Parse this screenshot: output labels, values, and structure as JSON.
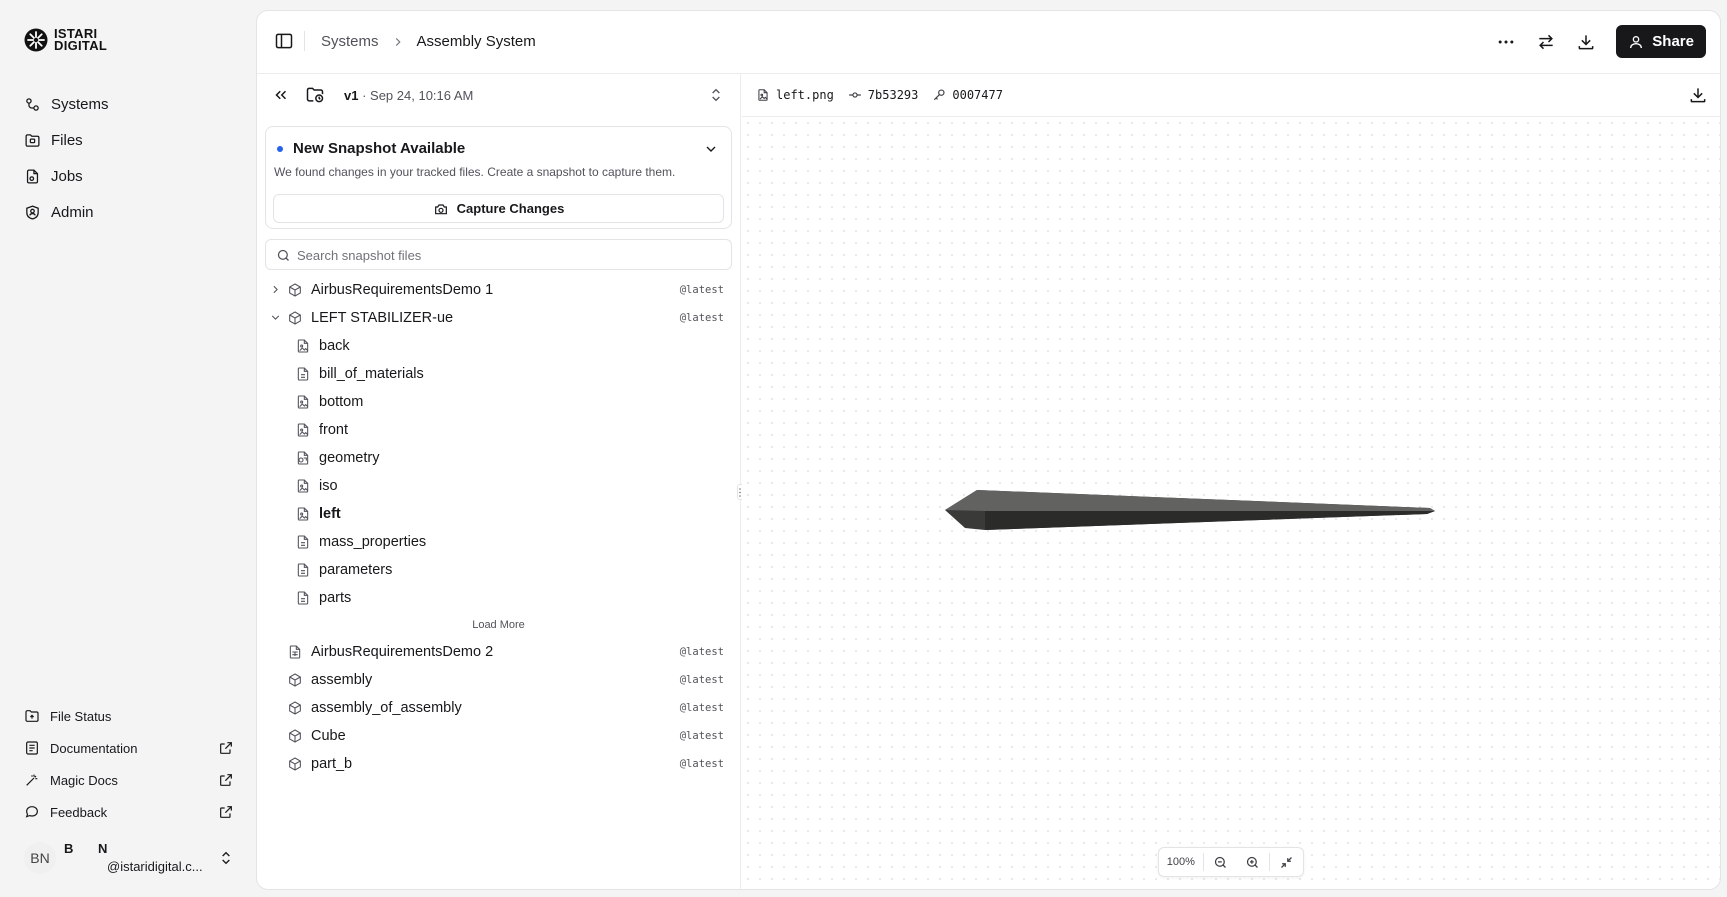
{
  "brand": {
    "line1": "ISTARI",
    "line2": "DIGITAL"
  },
  "nav": [
    {
      "label": "Systems",
      "icon": "systems-icon"
    },
    {
      "label": "Files",
      "icon": "files-icon"
    },
    {
      "label": "Jobs",
      "icon": "jobs-icon"
    },
    {
      "label": "Admin",
      "icon": "admin-icon"
    }
  ],
  "bottom_nav": [
    {
      "label": "File Status",
      "icon": "file-status-icon"
    },
    {
      "label": "Documentation",
      "icon": "documentation-icon",
      "external": true
    },
    {
      "label": "Magic Docs",
      "icon": "magic-wand-icon",
      "external": true
    },
    {
      "label": "Feedback",
      "icon": "chat-bubble-icon",
      "external": true
    }
  ],
  "user": {
    "initials": "BN",
    "first": "B",
    "last": "N",
    "email": "@istaridigital.c..."
  },
  "breadcrumb": {
    "parent": "Systems",
    "current": "Assembly System"
  },
  "toolbar": {
    "share_label": "Share"
  },
  "version": {
    "label": "v1",
    "date": "· Sep 24, 10:16 AM"
  },
  "snapshot": {
    "title": "New Snapshot Available",
    "description": "We found changes in your tracked files. Create a snapshot to capture them.",
    "capture_label": "Capture Changes"
  },
  "search": {
    "placeholder": "Search snapshot files"
  },
  "tree": {
    "top": [
      {
        "name": "AirbusRequirementsDemo 1",
        "tag": "@latest",
        "icon": "cube",
        "expanded": false
      },
      {
        "name": "LEFT STABILIZER-ue",
        "tag": "@latest",
        "icon": "cube",
        "expanded": true
      }
    ],
    "children": [
      {
        "name": "back",
        "icon": "image"
      },
      {
        "name": "bill_of_materials",
        "icon": "doc"
      },
      {
        "name": "bottom",
        "icon": "image"
      },
      {
        "name": "front",
        "icon": "image"
      },
      {
        "name": "geometry",
        "icon": "geometry"
      },
      {
        "name": "iso",
        "icon": "image"
      },
      {
        "name": "left",
        "icon": "image",
        "selected": true
      },
      {
        "name": "mass_properties",
        "icon": "doc"
      },
      {
        "name": "parameters",
        "icon": "doc"
      },
      {
        "name": "parts",
        "icon": "doc"
      }
    ],
    "load_more": "Load More",
    "bottom": [
      {
        "name": "AirbusRequirementsDemo 2",
        "tag": "@latest",
        "icon": "sheet"
      },
      {
        "name": "assembly",
        "tag": "@latest",
        "icon": "cube"
      },
      {
        "name": "assembly_of_assembly",
        "tag": "@latest",
        "icon": "cube"
      },
      {
        "name": "Cube",
        "tag": "@latest",
        "icon": "cube"
      },
      {
        "name": "part_b",
        "tag": "@latest",
        "icon": "cube"
      }
    ]
  },
  "viewer": {
    "filename": "left.png",
    "commit": "7b53293",
    "key": "0007477",
    "zoom": "100%"
  },
  "colors": {
    "accent": "#18181b",
    "dot": "#2563eb",
    "model": "#3a3a38"
  }
}
